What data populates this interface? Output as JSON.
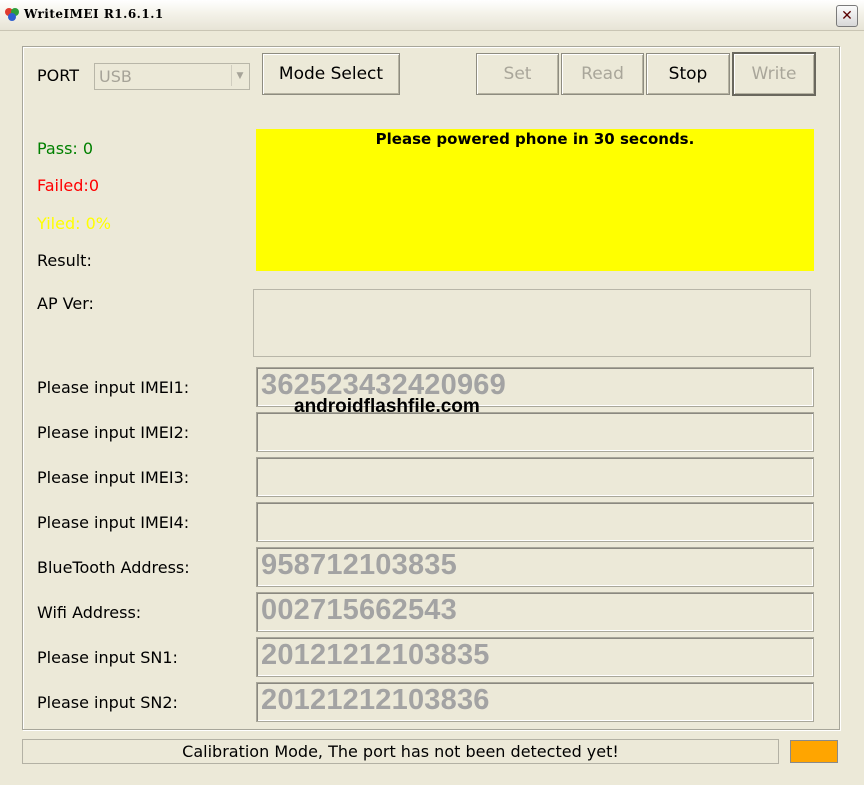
{
  "window": {
    "title": "WriteIMEI R1.6.1.1",
    "close_glyph": "✕",
    "icon": "app-logo-icon"
  },
  "port": {
    "label": "PORT",
    "value": "USB",
    "arrow_glyph": "▼"
  },
  "buttons": {
    "mode_select": "Mode Select",
    "set": "Set",
    "read": "Read",
    "stop": "Stop",
    "write": "Write"
  },
  "stats": {
    "pass": "Pass:  0",
    "failed": "Failed:0",
    "yield": "Yiled: 0%",
    "result": "Result:",
    "colors": {
      "pass": "#008000",
      "failed": "#ff0000",
      "yield": "#ffff00"
    }
  },
  "banner": {
    "message": "Please powered phone in 30 seconds.",
    "color": "#ffff00"
  },
  "ap_ver": {
    "label": "AP Ver:"
  },
  "watermark": "androidflashfile.com",
  "fields": [
    {
      "label": "Please input IMEI1:",
      "value": "362523432420969"
    },
    {
      "label": "Please input IMEI2:",
      "value": ""
    },
    {
      "label": "Please input IMEI3:",
      "value": ""
    },
    {
      "label": "Please input IMEI4:",
      "value": ""
    },
    {
      "label": "BlueTooth Address:",
      "value": "958712103835"
    },
    {
      "label": "Wifi Address:",
      "value": "002715662543"
    },
    {
      "label": "Please input SN1:",
      "value": "20121212103835"
    },
    {
      "label": "Please input SN2:",
      "value": "20121212103836"
    }
  ],
  "status": {
    "message": "Calibration Mode, The port has not been detected yet!",
    "indicator_color": "#ffa500"
  }
}
